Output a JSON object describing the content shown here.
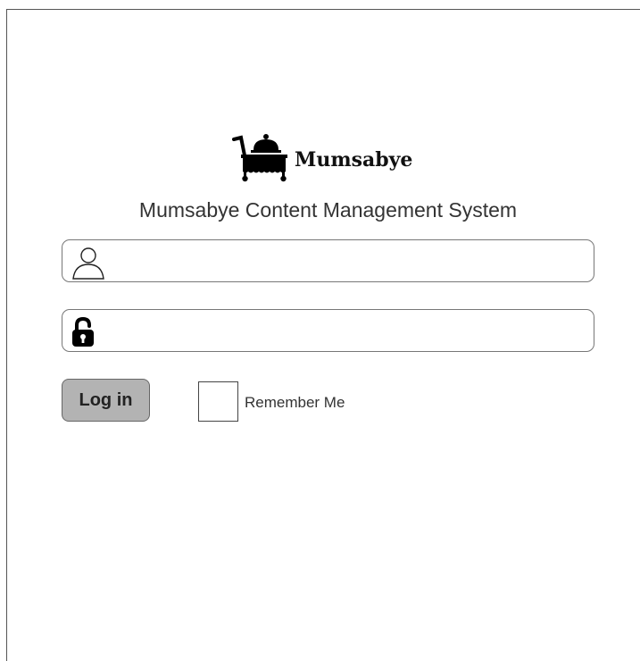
{
  "brand": {
    "name": "Mumsabye",
    "logo_icon": "serving-cart-icon"
  },
  "app_title": "Mumsabye Content Management System",
  "username": {
    "icon": "user-icon",
    "value": "",
    "placeholder": ""
  },
  "password": {
    "icon": "unlocked-padlock-icon",
    "value": "",
    "placeholder": ""
  },
  "login_button_label": "Log in",
  "remember_me": {
    "label": "Remember Me",
    "checked": false
  },
  "colors": {
    "button_fill": "#b3b3b3",
    "border": "#777777",
    "background": "#ffffff"
  }
}
